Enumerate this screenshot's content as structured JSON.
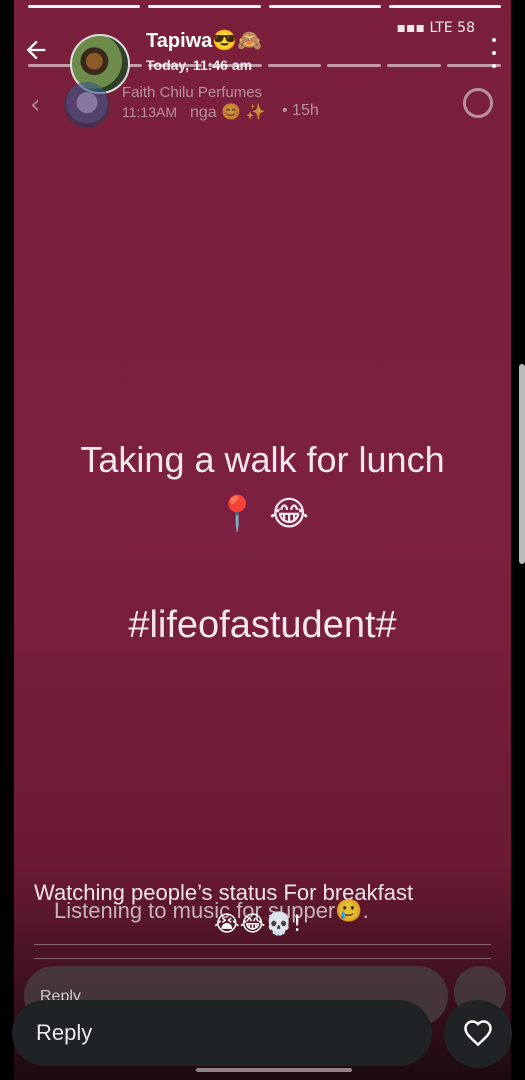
{
  "status": {
    "network": "LTE",
    "battery": "58"
  },
  "header": {
    "name": "Tapiwa😎🙈",
    "time": "Today, 11:46 am"
  },
  "previous_story": {
    "name": "Faith Chilu Perfumes",
    "time": "11:13AM",
    "extra": "nga 😊 ✨",
    "age": "• 15h"
  },
  "story": {
    "caption": "Taking a walk for lunch",
    "caption_emoji": "📍 😂",
    "hashtag": "#lifeofastudent#",
    "background": "#7a1f3b"
  },
  "previous_captions": {
    "line1": "Watching people’s status For breakfast",
    "line2": "Listening to music for supper🥲.",
    "emoji": "😭😂💀!"
  },
  "footer": {
    "reply_placeholder": "Reply",
    "ghost_reply": "Reply"
  },
  "icons": {
    "back": "arrow-left-icon",
    "menu": "more-vertical-icon",
    "heart": "heart-icon"
  }
}
